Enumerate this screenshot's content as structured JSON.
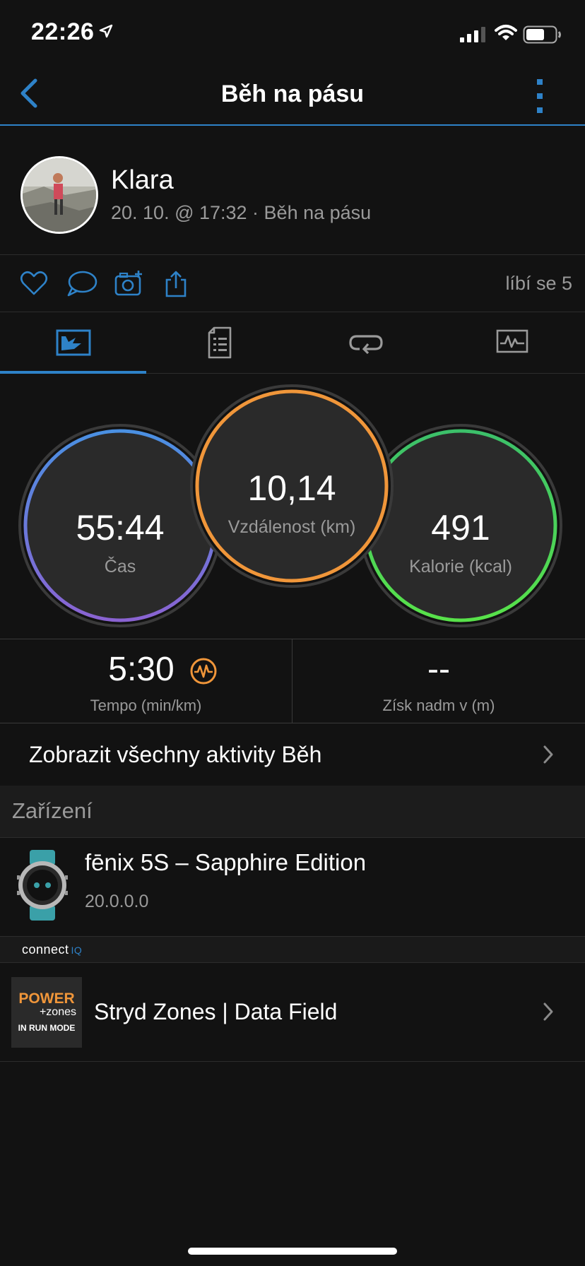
{
  "status_bar": {
    "time": "22:26"
  },
  "nav": {
    "title": "Běh na pásu"
  },
  "profile": {
    "name": "Klara",
    "subtitle": "20. 10. @ 17:32 · Běh na pásu"
  },
  "actions": {
    "likes": "líbí se 5"
  },
  "tabs": [
    {
      "icon": "activity-summary-icon",
      "active": true
    },
    {
      "icon": "details-icon",
      "active": false
    },
    {
      "icon": "laps-icon",
      "active": false
    },
    {
      "icon": "charts-icon",
      "active": false
    }
  ],
  "rings": {
    "time": {
      "value": "55:44",
      "label": "Čas",
      "color_top": "#4a90e2",
      "color_bottom": "#8a63d2"
    },
    "distance": {
      "value": "10,14",
      "label": "Vzdálenost (km)",
      "color": "#f0963a"
    },
    "calories": {
      "value": "491",
      "label": "Kalorie (kcal)",
      "color_top": "#3cc06a",
      "color_bottom": "#58e24a"
    }
  },
  "metrics": {
    "pace": {
      "value": "5:30",
      "label": "Tempo (min/km)",
      "icon": "pace-gauge-icon",
      "icon_color": "#f0963a"
    },
    "elevation": {
      "value": "--",
      "label": "Získ nadm v (m)"
    }
  },
  "link_row": {
    "label": "Zobrazit všechny aktivity Běh"
  },
  "devices_section": {
    "title": "Zařízení"
  },
  "device": {
    "name": "fēnix 5S – Sapphire Edition",
    "version": "20.0.0.0"
  },
  "connect_iq": {
    "brand": "connect",
    "brand_suffix": "IQ"
  },
  "app": {
    "name": "Stryd Zones | Data Field",
    "tile_line1": "POWER",
    "tile_line2": "+zones",
    "tile_line3": "IN RUN MODE"
  },
  "colors": {
    "accent": "#2e82c8",
    "background": "#121212"
  }
}
